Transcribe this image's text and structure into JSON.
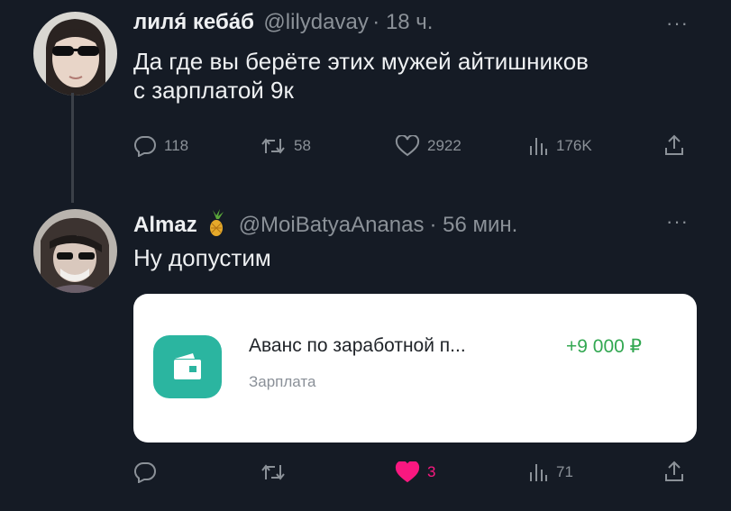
{
  "tweet1": {
    "display_name": "лиля́ кеба́б",
    "handle": "@lilydavay",
    "time": "· 18 ч.",
    "more": "···",
    "text_line1": "Да где вы берёте этих мужей айтишников",
    "text_line2": "с зарплатой 9к",
    "actions": {
      "replies": "118",
      "retweets": "58",
      "likes": "2922",
      "views": "176K"
    }
  },
  "tweet2": {
    "display_name": "Almaz",
    "handle": "@MoiBatyaAnanas",
    "time": "· 56 мин.",
    "more": "···",
    "text": "Ну допустим",
    "card": {
      "title": "Аванс по заработной п...",
      "amount": "+9 000 ₽",
      "subtitle": "Зарплата"
    },
    "actions": {
      "replies": "",
      "retweets": "",
      "likes": "3",
      "views": "71"
    }
  },
  "colors": {
    "background": "#151b25",
    "like_active": "#f91880",
    "amount_green": "#33a852",
    "wallet_teal": "#2bb5a0"
  },
  "icons": [
    "reply-icon",
    "retweet-icon",
    "heart-icon",
    "views-icon",
    "share-icon",
    "pineapple-icon",
    "wallet-icon",
    "more-icon"
  ]
}
